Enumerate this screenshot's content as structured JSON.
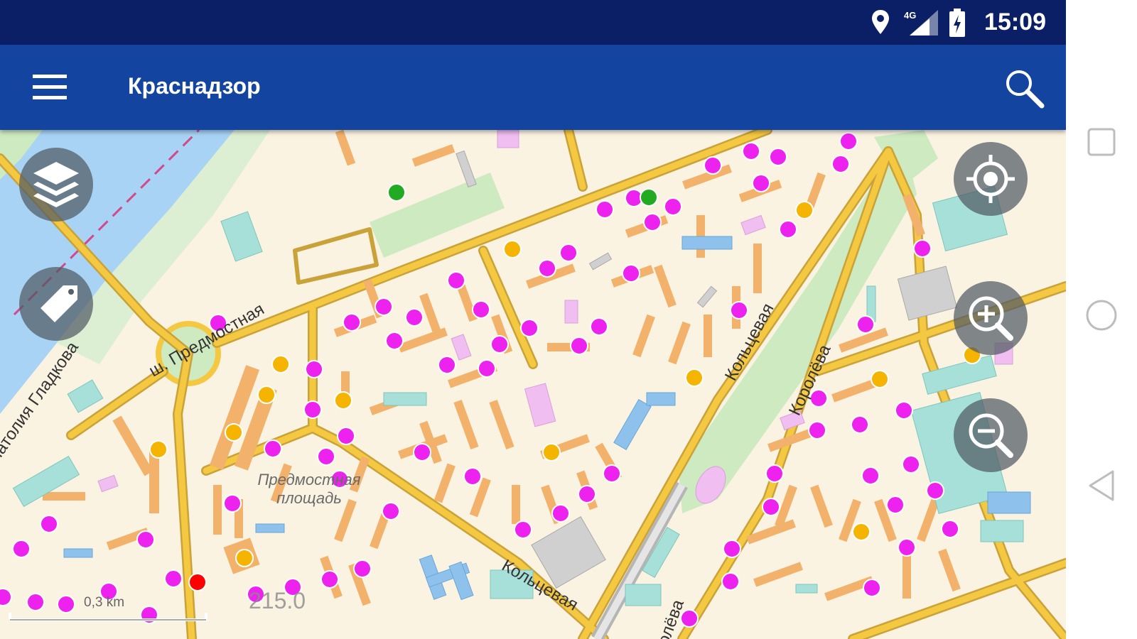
{
  "status_bar": {
    "time": "15:09",
    "network": "4G",
    "icons": [
      "location-icon",
      "signal-4g-icon",
      "battery-charging-icon"
    ]
  },
  "app_bar": {
    "title": "Краснадзор",
    "icons": [
      "hamburger-menu-icon",
      "search-icon"
    ]
  },
  "map": {
    "streets": {
      "gladkova": "Анатолия Гладкова",
      "predmostnaya": "ш. Предмостная",
      "koltsevaya_1": "Кольцевая",
      "koltsevaya_2": "Кольцевая",
      "koroleva_1": "Королёва",
      "koroleva_2": "олёва"
    },
    "place": "Предмостная площадь",
    "scale": "0,3 km",
    "zoom": "215.0",
    "controls": [
      "layers-icon",
      "tag-icon",
      "my-location-icon",
      "zoom-in-icon",
      "zoom-out-icon"
    ],
    "colors": {
      "marker_magenta": "#ee22ee",
      "marker_orange": "#f5b400",
      "marker_green": "#22aa22",
      "marker_red": "#ff0000",
      "road": "#f5c842",
      "water": "#a9d3f5",
      "park": "#cdeac0",
      "building": "#f2b26b"
    }
  },
  "nav_bar": {
    "icons": [
      "recent-apps-icon",
      "home-icon",
      "back-icon"
    ]
  }
}
